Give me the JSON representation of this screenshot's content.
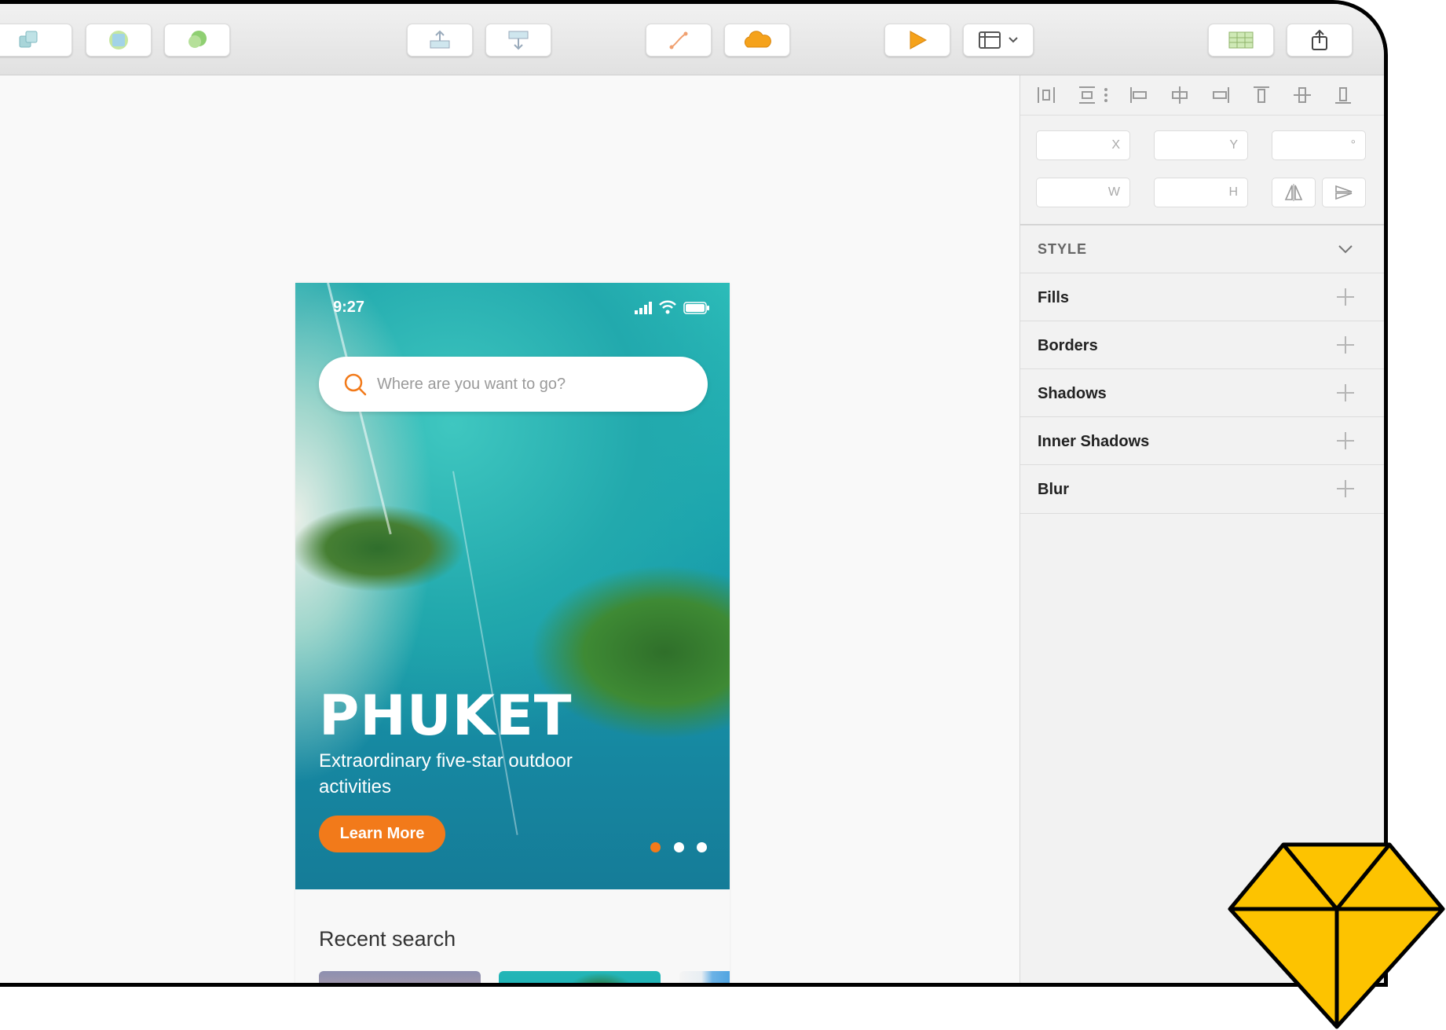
{
  "toolbar": {
    "buttons": [
      {
        "icon": "group-icon"
      },
      {
        "icon": "union-icon"
      },
      {
        "icon": "mask-icon"
      },
      {
        "icon": "move-forward-icon"
      },
      {
        "icon": "move-backward-icon"
      },
      {
        "icon": "vector-path-icon"
      },
      {
        "icon": "cloud-icon"
      },
      {
        "icon": "preview-play-icon"
      },
      {
        "icon": "view-layout-icon"
      },
      {
        "icon": "grid-icon"
      },
      {
        "icon": "share-export-icon"
      }
    ]
  },
  "artboard": {
    "status_time": "9:27",
    "search_placeholder": "Where are you want to go?",
    "hero_title": "PHUKET",
    "hero_subtitle": "Extraordinary five-star outdoor activities",
    "cta_label": "Learn More",
    "carousel": {
      "count": 3,
      "active_index": 0
    },
    "recent_title": "Recent search"
  },
  "inspector": {
    "fields": {
      "x": "X",
      "y": "Y",
      "rotation": "°",
      "w": "W",
      "h": "H"
    },
    "style_header": "STYLE",
    "sections": [
      "Fills",
      "Borders",
      "Shadows",
      "Inner Shadows",
      "Blur"
    ]
  },
  "colors": {
    "accent_orange": "#f27a1a",
    "logo_yellow": "#fdc300"
  }
}
